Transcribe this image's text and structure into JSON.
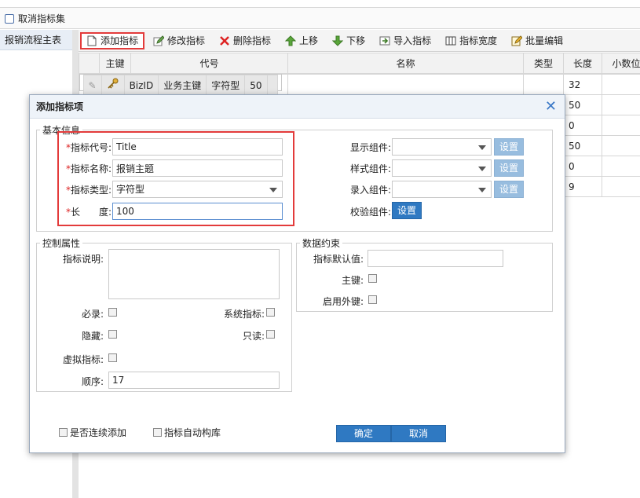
{
  "topbar": {
    "cancel_set_label": "取消指标集"
  },
  "leftpanel": {
    "item_label": "报销流程主表"
  },
  "toolbar": {
    "add": "添加指标",
    "edit": "修改指标",
    "delete": "删除指标",
    "up": "上移",
    "down": "下移",
    "import": "导入指标",
    "width": "指标宽度",
    "batch": "批量编辑"
  },
  "grid": {
    "headers": [
      "主键",
      "代号",
      "名称",
      "类型",
      "长度",
      "小数位数"
    ],
    "rows": [
      {
        "code": "BizID",
        "name": "业务主键",
        "type": "字符型",
        "length": "50"
      },
      {
        "length": "32"
      },
      {
        "length": "50"
      },
      {
        "length": "0"
      },
      {
        "length": "50"
      },
      {
        "length": "0"
      },
      {
        "length": "9"
      }
    ]
  },
  "dialog": {
    "title": "添加指标项",
    "basic": {
      "legend": "基本信息",
      "code_label": "指标代号:",
      "code_value": "Title",
      "name_label": "指标名称:",
      "name_value": "报销主题",
      "type_label": "指标类型:",
      "type_value": "字符型",
      "length_label": "长　　度:",
      "length_value": "100",
      "display_label": "显示组件:",
      "style_label": "样式组件:",
      "input_label": "录入组件:",
      "verify_label": "校验组件:",
      "set_btn": "设置"
    },
    "control": {
      "legend": "控制属性",
      "desc_label": "指标说明:",
      "required_label": "必录:",
      "system_label": "系统指标:",
      "hidden_label": "隐藏:",
      "readonly_label": "只读:",
      "virtual_label": "虚拟指标:",
      "order_label": "顺序:",
      "order_value": "17"
    },
    "constraint": {
      "legend": "数据约束",
      "default_label": "指标默认值:",
      "primary_label": "主键:",
      "foreign_label": "启用外键:"
    },
    "footer": {
      "continuous_label": "是否连续添加",
      "auto_build_label": "指标自动构库",
      "ok": "确定",
      "cancel": "取消"
    }
  },
  "colors": {
    "accent": "#2f79c2",
    "highlight": "#e33b3b"
  }
}
